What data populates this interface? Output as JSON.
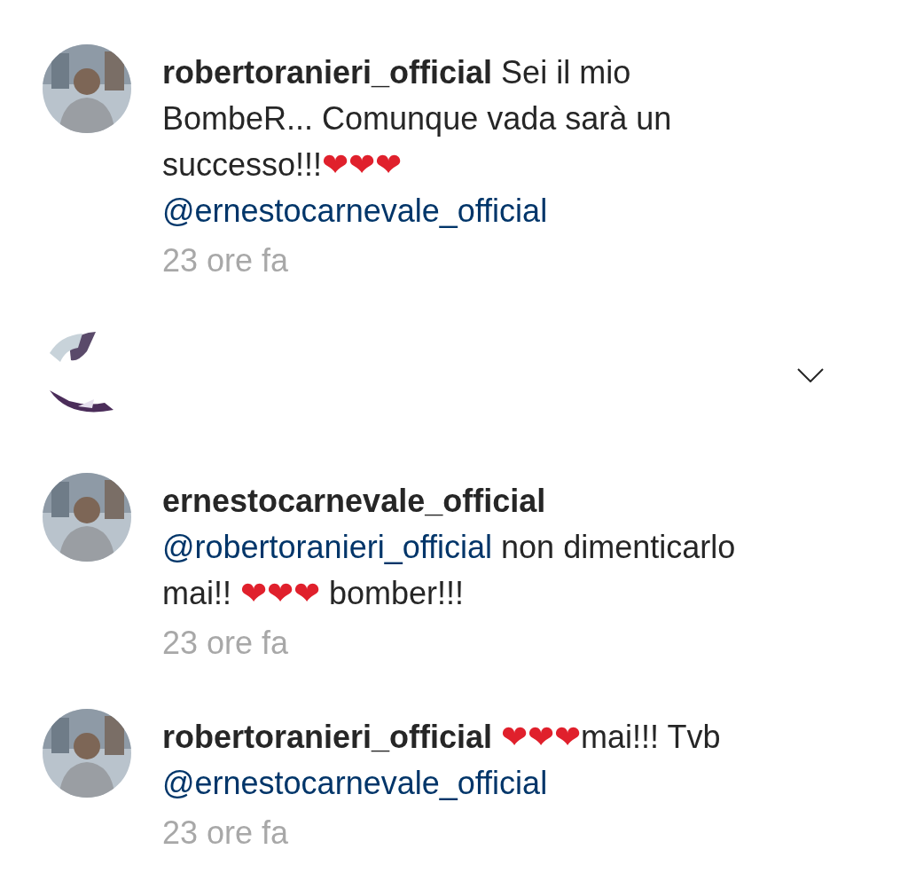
{
  "comments": [
    {
      "kind": "comment",
      "username": "robertoranieri_official",
      "parts": [
        {
          "kind": "text",
          "text": "Sei il mio BombeR... Comunque vada sarà un successo!!!"
        },
        {
          "kind": "emoji",
          "text": "❤❤❤"
        },
        {
          "kind": "mention",
          "text": "@ernestocarnevale_official"
        }
      ],
      "time": "23 ore fa"
    },
    {
      "kind": "redacted"
    },
    {
      "kind": "comment",
      "username": "ernestocarnevale_official",
      "parts": [
        {
          "kind": "mention",
          "text": "@robertoranieri_official"
        },
        {
          "kind": "text",
          "text": " non dimenticarlo mai!! "
        },
        {
          "kind": "emoji",
          "text": "❤❤❤"
        },
        {
          "kind": "text",
          "text": " bomber!!!"
        }
      ],
      "time": "23 ore fa"
    },
    {
      "kind": "comment",
      "username": "robertoranieri_official",
      "parts": [
        {
          "kind": "emoji",
          "text": "❤❤❤"
        },
        {
          "kind": "text",
          "text": "mai!!! Tvb "
        },
        {
          "kind": "mention",
          "text": "@ernestocarnevale_official"
        }
      ],
      "time": "23 ore fa"
    }
  ]
}
